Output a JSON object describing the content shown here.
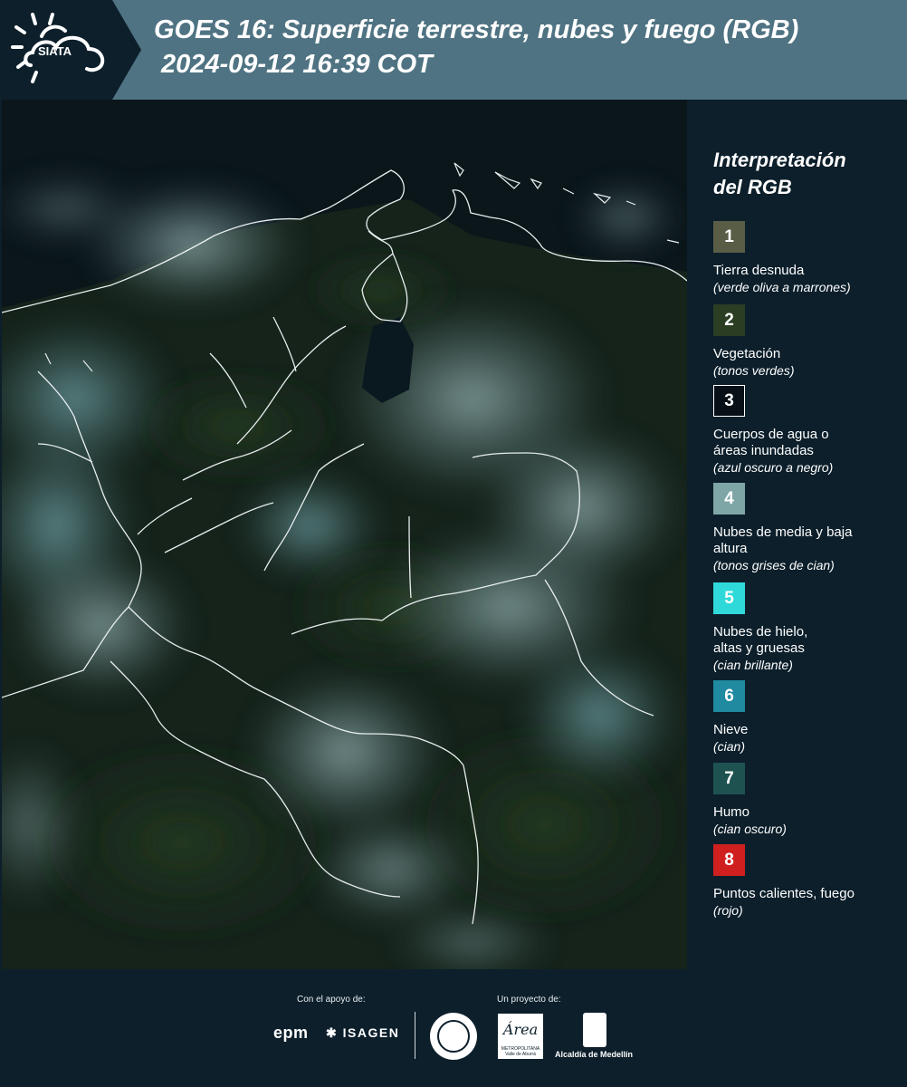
{
  "header": {
    "logo_text": "SIATA",
    "title_line1": "GOES 16: Superficie terrestre, nubes y fuego (RGB)",
    "title_line2": "2024-09-12 16:39 COT"
  },
  "legend": {
    "title_line1": "Interpretación",
    "title_line2": "del RGB",
    "items": [
      {
        "num": "1",
        "name": "Tierra desnuda",
        "sub": "(verde oliva a marrones)",
        "color": "#5a5d46"
      },
      {
        "num": "2",
        "name": "Vegetación",
        "sub": "(tonos verdes)",
        "color": "#2b3d22"
      },
      {
        "num": "3",
        "name": "Cuerpos de agua o áreas inundadas",
        "sub": "(azul oscuro a negro)",
        "color": "#071017"
      },
      {
        "num": "4",
        "name": "Nubes de media y baja altura",
        "sub": "(tonos grises de cian)",
        "color": "#7fa6a6"
      },
      {
        "num": "5",
        "name": "Nubes de hielo, altas y gruesas",
        "sub": "(cian brillante)",
        "color": "#2fd9d9"
      },
      {
        "num": "6",
        "name": "Nieve",
        "sub": "(cian)",
        "color": "#1f8aa0"
      },
      {
        "num": "7",
        "name": "Humo",
        "sub": "(cian oscuro)",
        "color": "#1e5250"
      },
      {
        "num": "8",
        "name": "Puntos calientes, fuego",
        "sub": "(rojo)",
        "color": "#cf1f1f"
      }
    ]
  },
  "footer": {
    "support_label": "Con el apoyo de:",
    "project_label": "Un proyecto de:",
    "epm": "epm",
    "isagen": "ISAGEN",
    "area_logo": "Área",
    "area_sub": "METROPOLITANA Valle de Aburrá",
    "medellin": "Alcaldía de Medellín"
  }
}
